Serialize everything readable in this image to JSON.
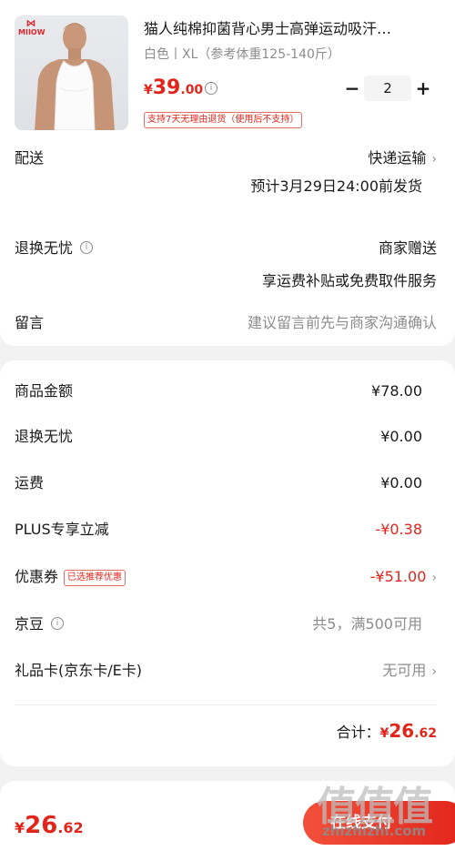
{
  "product": {
    "brand_logo_text": "MIIOW",
    "title": "猫人纯棉抑菌背心男士高弹运动吸汗…",
    "spec": "白色丨XL（参考体重125-140斤）",
    "price_symbol": "¥",
    "price_int": "39",
    "price_dec": ".00",
    "quantity": "2",
    "minus_label": "−",
    "plus_label": "+",
    "return_tag": "支持7天无理由退货（使用后不支持）"
  },
  "delivery": {
    "label": "配送",
    "method": "快递运输",
    "eta": "预计3月29日24:00前发货"
  },
  "return_worry": {
    "label": "退换无忧",
    "value": "商家赠送",
    "desc": "享运费补贴或免费取件服务"
  },
  "message": {
    "label": "留言",
    "placeholder": "建议留言前先与商家沟通确认"
  },
  "fees": {
    "goods_amount_label": "商品金额",
    "goods_amount": "¥78.00",
    "return_worry_label": "退换无忧",
    "return_worry_amount": "¥0.00",
    "shipping_label": "运费",
    "shipping_amount": "¥0.00",
    "plus_label": "PLUS专享立减",
    "plus_amount": "-¥0.38",
    "coupon_label": "优惠券",
    "coupon_tag": "已选推荐优惠",
    "coupon_amount": "-¥51.00",
    "jingdou_label": "京豆",
    "jingdou_value": "共5，满500可用",
    "giftcard_label": "礼品卡(京东卡/E卡)",
    "giftcard_value": "无可用",
    "total_label": "合计：",
    "total_symbol": "¥",
    "total_int": "26",
    "total_dec": ".62"
  },
  "footer": {
    "price_symbol": "¥",
    "price_int": "26",
    "price_dec": ".62",
    "pay_label": "在线支付"
  },
  "watermark": {
    "chars": "值值值",
    "url": "zhizhizhi.com"
  },
  "colors": {
    "accent": "#e1251b",
    "background": "#f2f2f2",
    "muted": "#8c8c8c"
  }
}
